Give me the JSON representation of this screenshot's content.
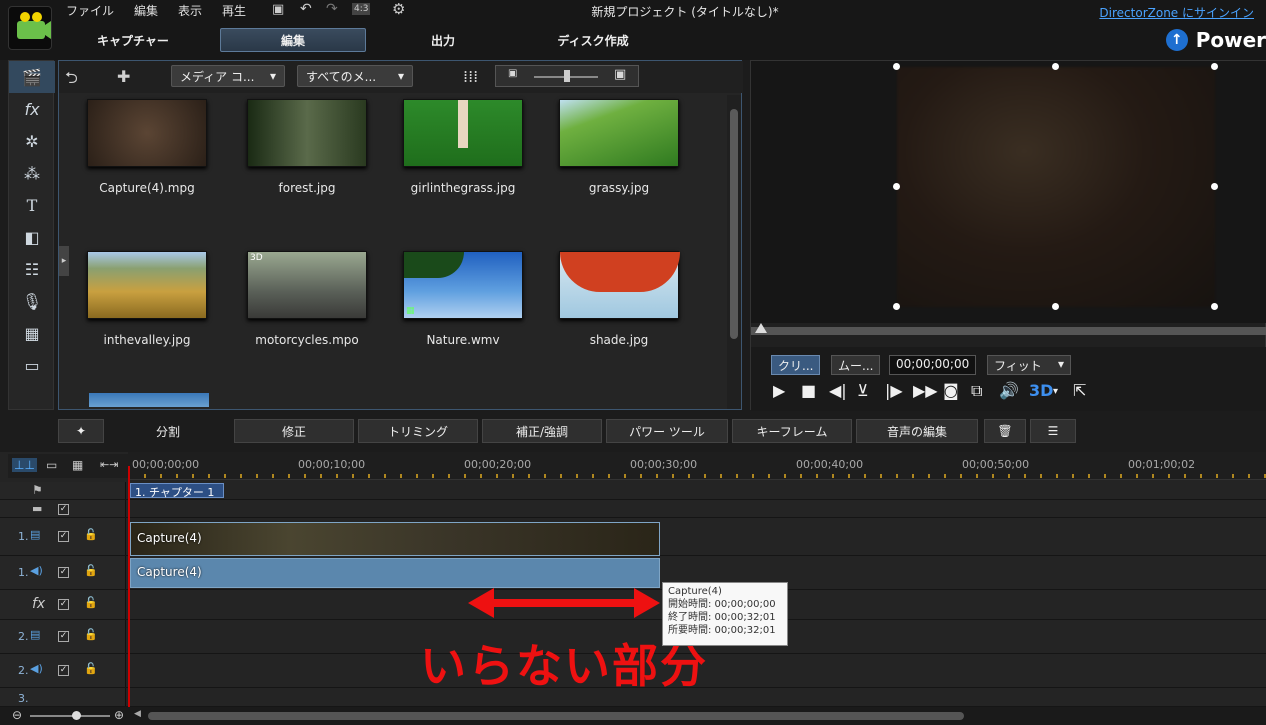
{
  "menu": {
    "file": "ファイル",
    "edit": "編集",
    "view": "表示",
    "play": "再生",
    "ratio": "4:3"
  },
  "window_title": "新規プロジェクト (タイトルなし)*",
  "signin": "DirectorZone にサインイン",
  "brand": "Power",
  "mode_tabs": [
    "キャプチャー",
    "編集",
    "出力",
    "ディスク作成"
  ],
  "library": {
    "dropdown_media": "メディア コ...",
    "dropdown_filter": "すべてのメ...",
    "items": [
      {
        "label": "Capture(4).mpg"
      },
      {
        "label": "forest.jpg"
      },
      {
        "label": "girlinthegrass.jpg"
      },
      {
        "label": "grassy.jpg"
      },
      {
        "label": "inthevalley.jpg"
      },
      {
        "label": "motorcycles.mpo",
        "badge": "3D"
      },
      {
        "label": "Nature.wmv"
      },
      {
        "label": "shade.jpg"
      }
    ]
  },
  "preview": {
    "clip_tab": "クリ...",
    "movie_tab": "ムー...",
    "timecode": "00;00;00;00",
    "fit": "フィット",
    "threed": "3D"
  },
  "functions": {
    "split": "分割",
    "fix": "修正",
    "trim": "トリミング",
    "enhance": "補正/強調",
    "power_tools": "パワー ツール",
    "keyframe": "キーフレーム",
    "audio_edit": "音声の編集"
  },
  "timeline": {
    "ruler": [
      "00;00;00;00",
      "00;00;10;00",
      "00;00;20;00",
      "00;00;30;00",
      "00;00;40;00",
      "00;00;50;00",
      "00;01;00;02"
    ],
    "chapter": "1. チャプター 1",
    "video_clip": "Capture(4)",
    "audio_clip": "Capture(4)",
    "track_labels": [
      "1.",
      "1.",
      "fx",
      "2.",
      "2.",
      "3."
    ],
    "tooltip": {
      "title": "Capture(4)",
      "start": "開始時間: 00;00;00;00",
      "end": "終了時間: 00;00;32;01",
      "duration": "所要時間: 00;00;32;01"
    }
  },
  "annotation": "いらない部分",
  "colors": {
    "accent": "#4aa3ff",
    "annotation_red": "#ee1111",
    "clip_blue": "#5b87ad"
  }
}
